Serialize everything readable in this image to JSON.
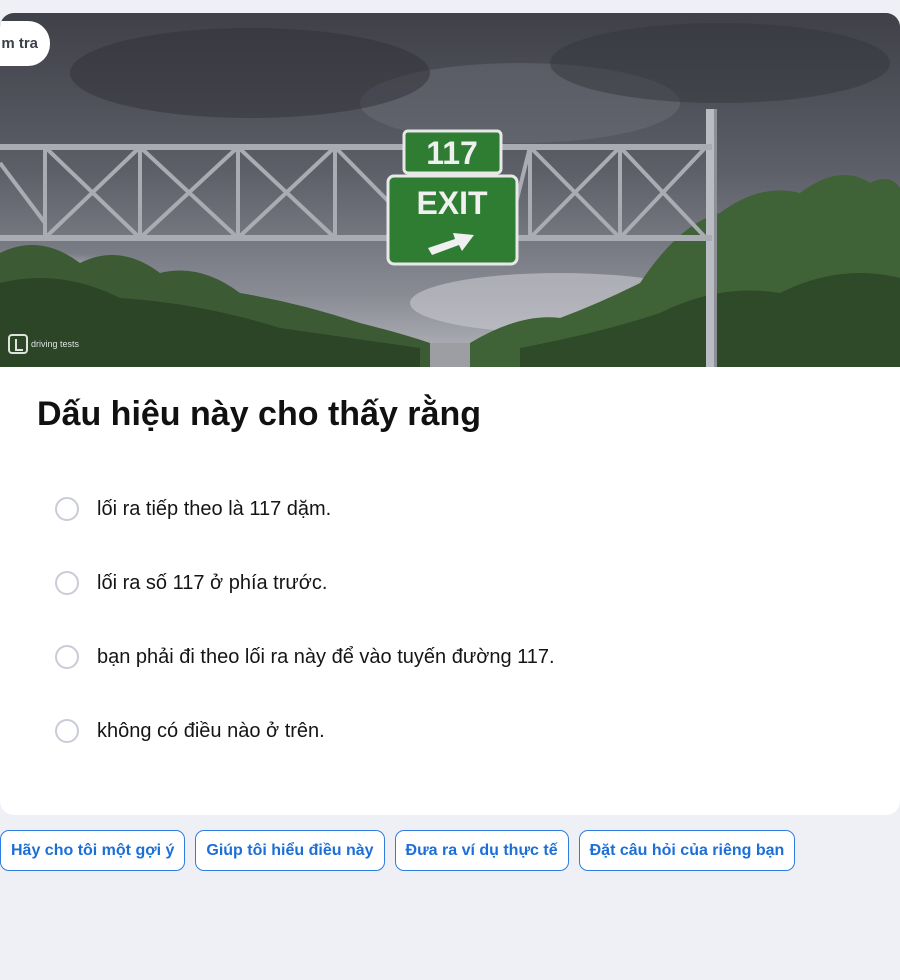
{
  "quiz": {
    "tag_label": "m tra",
    "image_alt_logo": "driving tests",
    "sign": {
      "number": "117",
      "word": "EXIT"
    },
    "question": "Dấu hiệu này cho thấy rằng",
    "options": [
      {
        "label": "lối ra tiếp theo là 117 dặm."
      },
      {
        "label": "lối ra số 117 ở phía trước."
      },
      {
        "label": "bạn phải đi theo lối ra này để vào tuyến đường 117."
      },
      {
        "label": "không có điều nào ở trên."
      }
    ]
  },
  "actions": [
    {
      "label": "Hãy cho tôi một gợi ý"
    },
    {
      "label": "Giúp tôi hiểu điều này"
    },
    {
      "label": "Đưa ra ví dụ thực tế"
    },
    {
      "label": "Đặt câu hỏi của riêng bạn"
    }
  ],
  "colors": {
    "sign_green": "#2e7d32",
    "accent_blue": "#1d6fd8",
    "page_background": "#eef0f6"
  }
}
